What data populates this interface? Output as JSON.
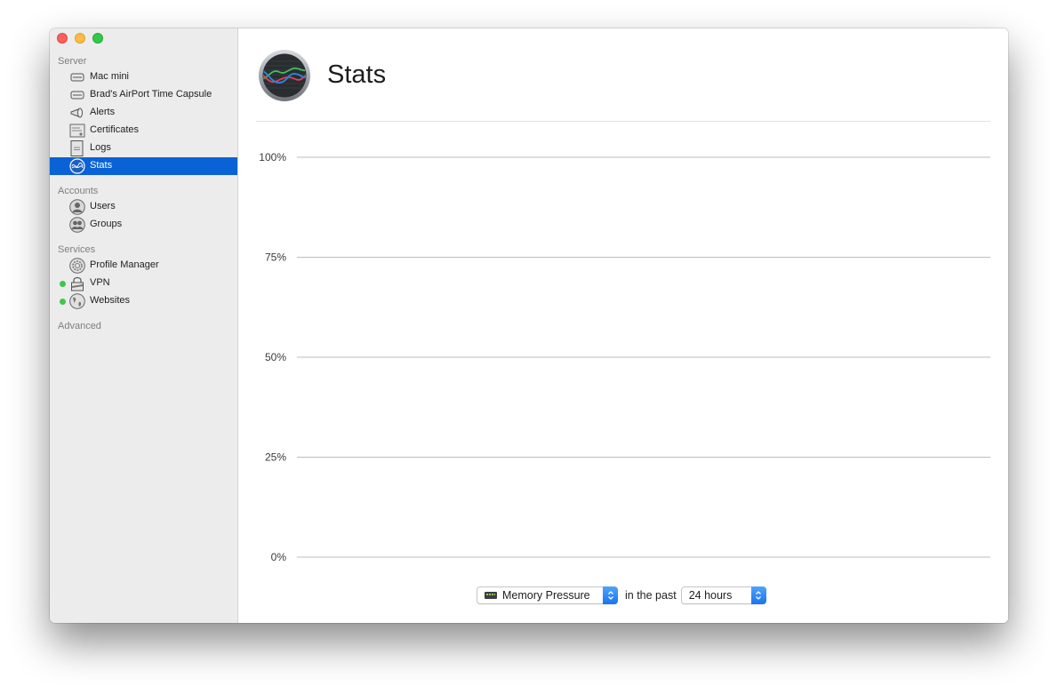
{
  "sidebar": {
    "sections": {
      "server": "Server",
      "accounts": "Accounts",
      "services": "Services",
      "advanced": "Advanced"
    },
    "server_items": [
      {
        "label": "Mac mini",
        "icon": "mac-mini-icon"
      },
      {
        "label": "Brad's AirPort Time Capsule",
        "icon": "time-capsule-icon"
      },
      {
        "label": "Alerts",
        "icon": "megaphone-icon"
      },
      {
        "label": "Certificates",
        "icon": "certificate-icon"
      },
      {
        "label": "Logs",
        "icon": "log-document-icon"
      },
      {
        "label": "Stats",
        "icon": "stats-icon",
        "selected": true
      }
    ],
    "account_items": [
      {
        "label": "Users",
        "icon": "user-icon"
      },
      {
        "label": "Groups",
        "icon": "group-icon"
      }
    ],
    "service_items": [
      {
        "label": "Profile Manager",
        "icon": "gear-icon",
        "running": false
      },
      {
        "label": "VPN",
        "icon": "lock-icon",
        "running": true
      },
      {
        "label": "Websites",
        "icon": "globe-icon",
        "running": true
      }
    ],
    "colors": {
      "selected": "#0a63d6",
      "status_running": "#3ec84a"
    }
  },
  "header": {
    "title": "Stats"
  },
  "chart_data": {
    "type": "line",
    "title": "",
    "xlabel": "",
    "ylabel": "",
    "ylim": [
      0,
      100
    ],
    "yticks": [
      "100%",
      "75%",
      "50%",
      "25%",
      "0%"
    ],
    "ytick_values": [
      100,
      75,
      50,
      25,
      0
    ],
    "grid": true,
    "series": []
  },
  "controls": {
    "metric": "Memory Pressure",
    "connector": "in the past",
    "range": "24 hours"
  }
}
